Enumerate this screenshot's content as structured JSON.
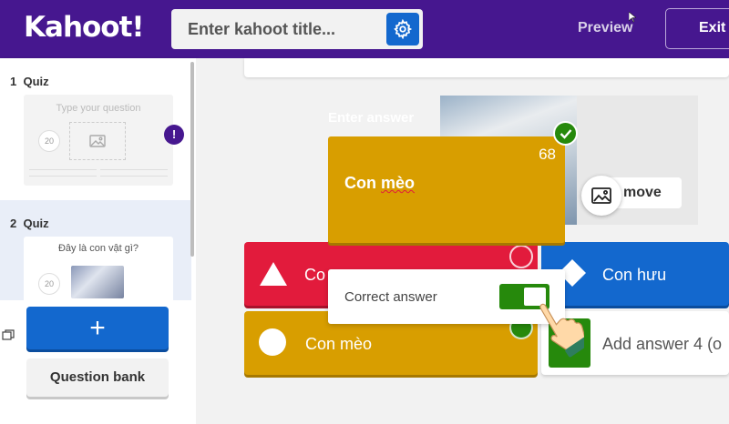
{
  "header": {
    "logo": "Kahoot!",
    "title_placeholder": "Enter kahoot title...",
    "preview_label": "Preview",
    "exit_label": "Exit"
  },
  "sidebar": {
    "slides": [
      {
        "number": "1",
        "type": "Quiz",
        "question": "Type your question",
        "timer": "20"
      },
      {
        "number": "2",
        "type": "Quiz",
        "question": "Đây là con vật gì?",
        "timer": "20"
      }
    ],
    "warning_mark": "!",
    "add_label": "+",
    "question_bank_label": "Question bank"
  },
  "media": {
    "remove_label": "move"
  },
  "answers": [
    {
      "label": "Co",
      "color": "#e21b3c",
      "shape": "triangle"
    },
    {
      "label": "Con hưu",
      "color": "#1368ce",
      "shape": "diamond"
    },
    {
      "label": "Con mèo",
      "color": "#d89e00",
      "shape": "circle"
    },
    {
      "label": "Add answer 4 (o",
      "color": "#26890c",
      "shape": "square"
    }
  ],
  "popup": {
    "heading": "Enter answer",
    "char_count": "68",
    "answer_text": "Con mèo",
    "correct_label": "Correct answer",
    "correct_on": true
  },
  "colors": {
    "brand_purple": "#46178f",
    "red": "#e21b3c",
    "blue": "#1368ce",
    "yellow": "#d89e00",
    "green": "#26890c"
  }
}
